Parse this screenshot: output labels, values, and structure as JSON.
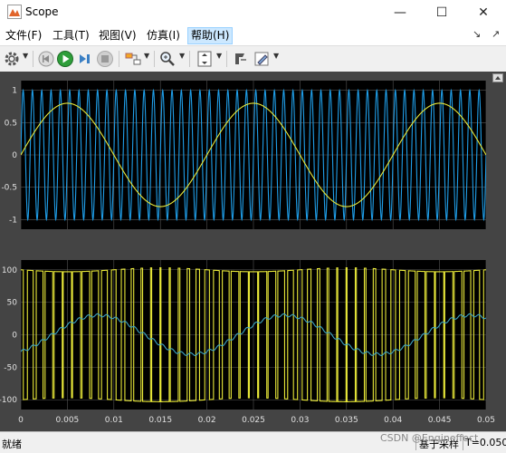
{
  "window": {
    "title": "Scope",
    "minimize": "—",
    "maximize": "☐",
    "close": "✕"
  },
  "menu": {
    "items": [
      {
        "label": "文件(F)"
      },
      {
        "label": "工具(T)"
      },
      {
        "label": "视图(V)"
      },
      {
        "label": "仿真(I)"
      },
      {
        "label": "帮助(H)",
        "active": true
      }
    ],
    "pin": "↘",
    "undock": "↗"
  },
  "toolbar": {
    "icons": [
      "gear-icon",
      "stop-back-icon",
      "run-icon",
      "step-forward-icon",
      "stop-icon",
      "highlight-block-icon",
      "zoom-icon",
      "autoscale-icon",
      "cursor-measure-icon",
      "edit-icon"
    ]
  },
  "colors": {
    "plot_bg": "#000000",
    "frame_bg": "#444444",
    "grid": "#555555",
    "tick_text": "#e0e0e0",
    "blue_signal": "#1f9ee8",
    "yellow_signal": "#e8e839",
    "teal_signal": "#3ea6c4"
  },
  "chart_data": [
    {
      "type": "line",
      "panel": "top",
      "xlim": [
        0,
        0.05
      ],
      "ylim": [
        -1.15,
        1.15
      ],
      "yticks": [
        "1",
        "0.5",
        "0",
        "-0.5",
        "-1"
      ],
      "ytick_values": [
        1,
        0.5,
        0,
        -0.5,
        -1
      ],
      "grid": true,
      "series": [
        {
          "color": "#1f9ee8",
          "amplitude": 1,
          "frequency_hz": 1000,
          "shape": "sine"
        },
        {
          "color": "#e8e839",
          "amplitude": 0.8,
          "frequency_hz": 50,
          "shape": "sine"
        }
      ]
    },
    {
      "type": "line",
      "panel": "bottom",
      "xlim": [
        0,
        0.05
      ],
      "ylim": [
        -115,
        115
      ],
      "yticks": [
        "100",
        "50",
        "0",
        "-50",
        "-100"
      ],
      "ytick_values": [
        100,
        50,
        0,
        -50,
        -100
      ],
      "xticks": [
        "0",
        "0.005",
        "0.01",
        "0.015",
        "0.02",
        "0.025",
        "0.03",
        "0.035",
        "0.04",
        "0.045",
        "0.05"
      ],
      "xtick_values": [
        0,
        0.005,
        0.01,
        0.015,
        0.02,
        0.025,
        0.03,
        0.035,
        0.04,
        0.045,
        0.05
      ],
      "grid": true,
      "series": [
        {
          "color": "#e8e839",
          "shape": "pwm",
          "amplitude": 100,
          "carrier_hz": 1000,
          "modulation_index": 0.8
        },
        {
          "color": "#3ea6c4",
          "shape": "sine",
          "amplitude": 30,
          "frequency_hz": 50,
          "phase_deg": -60
        }
      ]
    }
  ],
  "status": {
    "left": "就绪",
    "mode": "基于采样",
    "time": "T=0.050"
  },
  "watermark": "CSDN @Engineffect"
}
